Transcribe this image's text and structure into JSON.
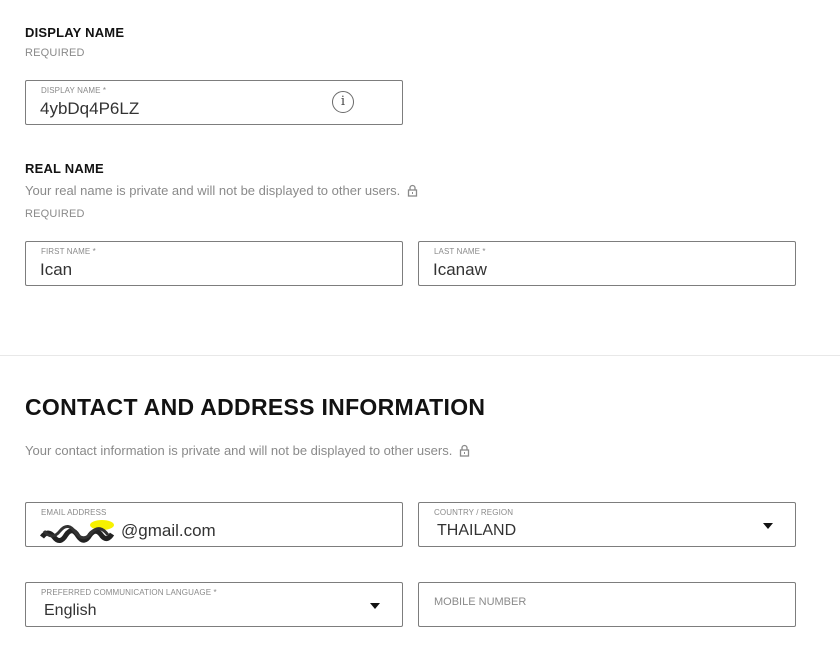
{
  "display_name_section": {
    "title": "DISPLAY NAME",
    "required": "REQUIRED",
    "field_label": "DISPLAY NAME *",
    "field_value": "4ybDq4P6LZ",
    "info_icon": "info-icon"
  },
  "real_name_section": {
    "title": "REAL NAME",
    "description": "Your real name is private and will not be displayed to other users.",
    "lock_icon": "lock-icon",
    "required": "REQUIRED",
    "first_name_label": "FIRST NAME *",
    "first_name_value": "Ican",
    "last_name_label": "LAST NAME *",
    "last_name_value": "Icanaw"
  },
  "contact_section": {
    "title": "CONTACT AND ADDRESS INFORMATION",
    "description": "Your contact information is private and will not be displayed to other users.",
    "email_label": "EMAIL ADDRESS",
    "email_value_visible": "@gmail.com",
    "country_label": "COUNTRY / REGION",
    "country_value": "THAILAND",
    "language_label": "PREFERRED COMMUNICATION LANGUAGE *",
    "language_value": "English",
    "mobile_placeholder": "MOBILE NUMBER"
  }
}
